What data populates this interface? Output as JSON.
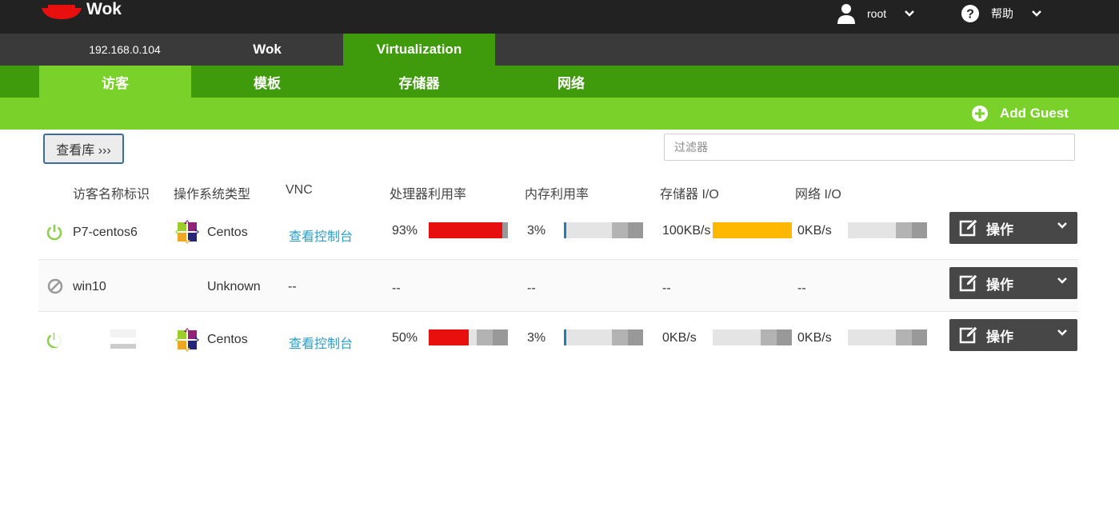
{
  "app": {
    "name": "Wok",
    "brand_color": "#e8100f"
  },
  "topbar": {
    "user": {
      "name": "root",
      "icon": "user-icon"
    },
    "help": {
      "label": "帮助",
      "icon": "help-circle-icon"
    }
  },
  "host_tabs": [
    {
      "label": "192.168.0.104",
      "active": false
    },
    {
      "label": "Wok",
      "active": false
    },
    {
      "label": "Virtualization",
      "active": true
    }
  ],
  "sub_tabs": [
    {
      "label": "访客",
      "active": true
    },
    {
      "label": "模板",
      "active": false
    },
    {
      "label": "存储器",
      "active": false
    },
    {
      "label": "网络",
      "active": false
    }
  ],
  "actions": {
    "add_guest": "Add Guest",
    "gallery": "查看库 ›››"
  },
  "filter": {
    "placeholder": "过滤器",
    "value": ""
  },
  "table": {
    "headers": [
      "访客名称标识",
      "操作系统类型",
      "VNC",
      "处理器利用率",
      "内存利用率",
      "存储器 I/O",
      "网络 I/O"
    ],
    "rows": [
      {
        "status": "running",
        "name": "P7-centos6",
        "os": "Centos",
        "vnc": "查看控制台",
        "cpu": "93%",
        "cpu_fraction": 0.93,
        "memory": "3%",
        "memory_fraction": 0.03,
        "storage_io": "100KB/s",
        "storage_fraction": 1.0,
        "network_io": "0KB/s",
        "network_fraction": 0.0,
        "action": "操作"
      },
      {
        "status": "stopped",
        "name": "win10",
        "os": "Unknown",
        "vnc": "--",
        "cpu": "--",
        "memory": "--",
        "storage_io": "--",
        "network_io": "--",
        "action": "操作"
      },
      {
        "status": "running",
        "name": "",
        "os": "Centos",
        "vnc": "查看控制台",
        "cpu": "50%",
        "cpu_fraction": 0.5,
        "memory": "3%",
        "memory_fraction": 0.03,
        "storage_io": "0KB/s",
        "storage_fraction": 0.0,
        "network_io": "0KB/s",
        "network_fraction": 0.0,
        "action": "操作"
      }
    ]
  },
  "colors": {
    "topbar": "#222222",
    "hostbar": "#3a3a3a",
    "green_dark": "#3f9b0c",
    "green_light": "#79d12a",
    "cpu_bar": "#e8100f",
    "storage_bar": "#ffb800",
    "memory_bar": "#1f7fb0",
    "running_icon": "#8cd04a",
    "stopped_icon": "#999999"
  }
}
